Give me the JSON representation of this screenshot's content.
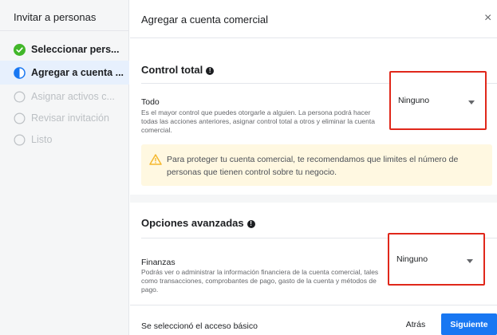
{
  "sidebar": {
    "title": "Invitar a personas",
    "steps": [
      {
        "label": "Seleccionar pers...",
        "state": "done",
        "icon": "check-circle-icon"
      },
      {
        "label": "Agregar a cuenta ...",
        "state": "current",
        "icon": "half-circle-icon"
      },
      {
        "label": "Asignar activos c...",
        "state": "pending",
        "icon": "empty-circle-icon"
      },
      {
        "label": "Revisar invitación",
        "state": "pending",
        "icon": "empty-circle-icon"
      },
      {
        "label": "Listo",
        "state": "pending",
        "icon": "empty-circle-icon"
      }
    ]
  },
  "header": {
    "title": "Agregar a cuenta comercial",
    "close_glyph": "×"
  },
  "control_total": {
    "title": "Control total",
    "info_glyph": "!",
    "permission": {
      "label": "Todo",
      "description": "Es el mayor control que puedes otorgarle a alguien. La persona podrá hacer todas las acciones anteriores, asignar control total a otros y eliminar la cuenta comercial.",
      "value": "Ninguno"
    }
  },
  "warning": {
    "text": "Para proteger tu cuenta comercial, te recomendamos que limites el número de personas que tienen control sobre tu negocio."
  },
  "advanced": {
    "title": "Opciones avanzadas",
    "info_glyph": "!",
    "permission": {
      "label": "Finanzas",
      "description": "Podrás ver o administrar la información financiera de la cuenta comercial, tales como transacciones, comprobantes de pago, gasto de la cuenta y métodos de pago.",
      "value": "Ninguno"
    }
  },
  "footer": {
    "status": "Se seleccionó el acceso básico",
    "back_label": "Atrás",
    "next_label": "Siguiente"
  },
  "colors": {
    "primary": "#1877f2",
    "done": "#42b72a",
    "highlight": "#e0271a",
    "warning_bg": "#fff8e1",
    "warning_icon": "#f5b82e"
  }
}
